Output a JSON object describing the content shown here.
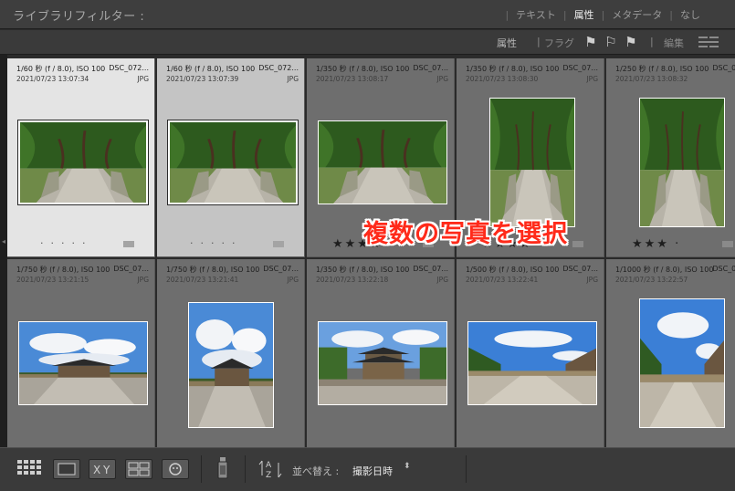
{
  "filter_bar": {
    "title": "ライブラリフィルター :",
    "tabs": [
      {
        "label": "テキスト",
        "active": false
      },
      {
        "label": "属性",
        "active": true
      },
      {
        "label": "メタデータ",
        "active": false
      },
      {
        "label": "なし",
        "active": false
      }
    ]
  },
  "attribute_bar": {
    "label": "属性",
    "flag_label": "フラグ",
    "edit_label": "編集"
  },
  "cells": [
    {
      "exposure": "1/60 秒 (f / 8.0), ISO 100",
      "filename": "DSC_072...",
      "date": "2021/07/23 13:07:34",
      "ext": "JPG",
      "state": "primary",
      "rating": 0,
      "orientation": "landscape"
    },
    {
      "exposure": "1/60 秒 (f / 8.0), ISO 100",
      "filename": "DSC_072...",
      "date": "2021/07/23 13:07:39",
      "ext": "JPG",
      "state": "secondary",
      "rating": 0,
      "orientation": "landscape"
    },
    {
      "exposure": "1/350 秒 (f / 8.0), ISO 100",
      "filename": "DSC_07...",
      "date": "2021/07/23 13:08:17",
      "ext": "JPG",
      "state": "none",
      "rating": 4,
      "orientation": "landscape"
    },
    {
      "exposure": "1/350 秒 (f / 8.0), ISO 100",
      "filename": "DSC_07...",
      "date": "2021/07/23 13:08:30",
      "ext": "JPG",
      "state": "none",
      "rating": 4,
      "orientation": "portrait"
    },
    {
      "exposure": "1/250 秒 (f / 8.0), ISO 100",
      "filename": "DSC_07...",
      "date": "2021/07/23 13:08:32",
      "ext": "JPG",
      "state": "none",
      "rating": 3,
      "orientation": "portrait"
    },
    {
      "exposure": "1/750 秒 (f / 8.0), ISO 100",
      "filename": "DSC_07...",
      "date": "2021/07/23 13:21:15",
      "ext": "JPG",
      "state": "none",
      "rating": 0,
      "orientation": "landscape"
    },
    {
      "exposure": "1/750 秒 (f / 8.0), ISO 100",
      "filename": "DSC_07...",
      "date": "2021/07/23 13:21:41",
      "ext": "JPG",
      "state": "none",
      "rating": 0,
      "orientation": "square"
    },
    {
      "exposure": "1/350 秒 (f / 8.0), ISO 100",
      "filename": "DSC_07...",
      "date": "2021/07/23 13:22:18",
      "ext": "JPG",
      "state": "none",
      "rating": 0,
      "orientation": "landscape"
    },
    {
      "exposure": "1/500 秒 (f / 8.0), ISO 100",
      "filename": "DSC_07...",
      "date": "2021/07/23 13:22:41",
      "ext": "JPG",
      "state": "none",
      "rating": 0,
      "orientation": "landscape"
    },
    {
      "exposure": "1/1000 秒 (f / 8.0), ISO 100",
      "filename": "DSC_07...",
      "date": "2021/07/23 13:22:57",
      "ext": "JPG",
      "state": "none",
      "rating": 0,
      "orientation": "portrait"
    }
  ],
  "callout": "複数の写真を選択",
  "toolbar": {
    "sort_label": "並べ替え :",
    "sort_value": "撮影日時"
  },
  "colors": {
    "callout_text": "#ff2a1a",
    "primary_selection": "#e4e4e4",
    "secondary_selection": "#c4c4c4",
    "cell_bg": "#6e6e6e"
  },
  "icons": [
    "grid-view-icon",
    "loupe-view-icon",
    "compare-view-icon",
    "survey-view-icon",
    "people-view-icon",
    "painter-icon",
    "sort-direction-icon",
    "sort-dropdown-icon",
    "pick-flag-icon",
    "unflag-icon",
    "reject-flag-icon"
  ]
}
